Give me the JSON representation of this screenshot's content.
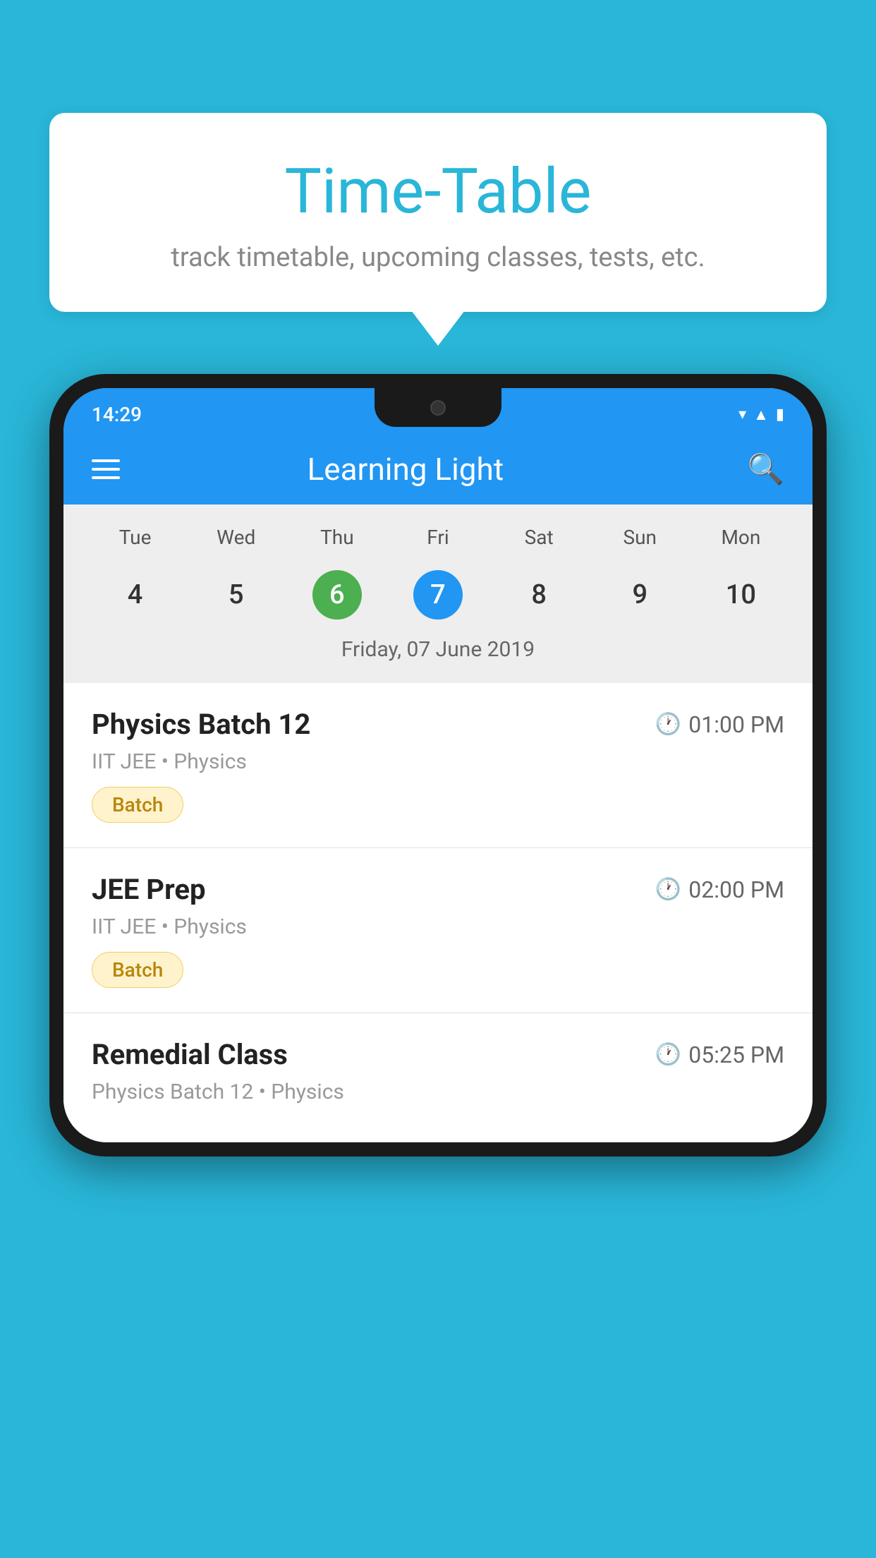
{
  "background_color": "#29B6D8",
  "bubble": {
    "title": "Time-Table",
    "subtitle": "track timetable, upcoming classes, tests, etc."
  },
  "phone": {
    "status_bar": {
      "time": "14:29"
    },
    "app_bar": {
      "title": "Learning Light"
    },
    "calendar": {
      "days": [
        "Tue",
        "Wed",
        "Thu",
        "Fri",
        "Sat",
        "Sun",
        "Mon"
      ],
      "dates": [
        "4",
        "5",
        "6",
        "7",
        "8",
        "9",
        "10"
      ],
      "today_index": 2,
      "selected_index": 3,
      "selected_label": "Friday, 07 June 2019"
    },
    "schedule": {
      "items": [
        {
          "title": "Physics Batch 12",
          "time": "01:00 PM",
          "meta": "IIT JEE • Physics",
          "badge": "Batch"
        },
        {
          "title": "JEE Prep",
          "time": "02:00 PM",
          "meta": "IIT JEE • Physics",
          "badge": "Batch"
        },
        {
          "title": "Remedial Class",
          "time": "05:25 PM",
          "meta": "Physics Batch 12 • Physics",
          "badge": null
        }
      ]
    }
  }
}
